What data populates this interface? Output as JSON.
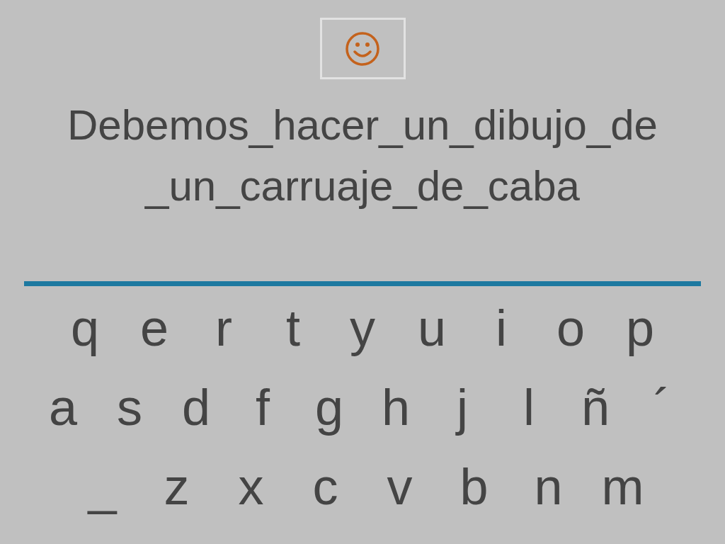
{
  "prompt_lines": [
    "Debemos_hacer_un_dibujo_de",
    "_un_carruaje_de_caba"
  ],
  "keyboard": [
    [
      "q",
      "e",
      "r",
      "t",
      "y",
      "u",
      "i",
      "o",
      "p"
    ],
    [
      "a",
      "s",
      "d",
      "f",
      "g",
      "h",
      "j",
      "l",
      "ñ",
      "´"
    ],
    [
      "_",
      "z",
      "x",
      "c",
      "v",
      "b",
      "n",
      "m"
    ]
  ]
}
